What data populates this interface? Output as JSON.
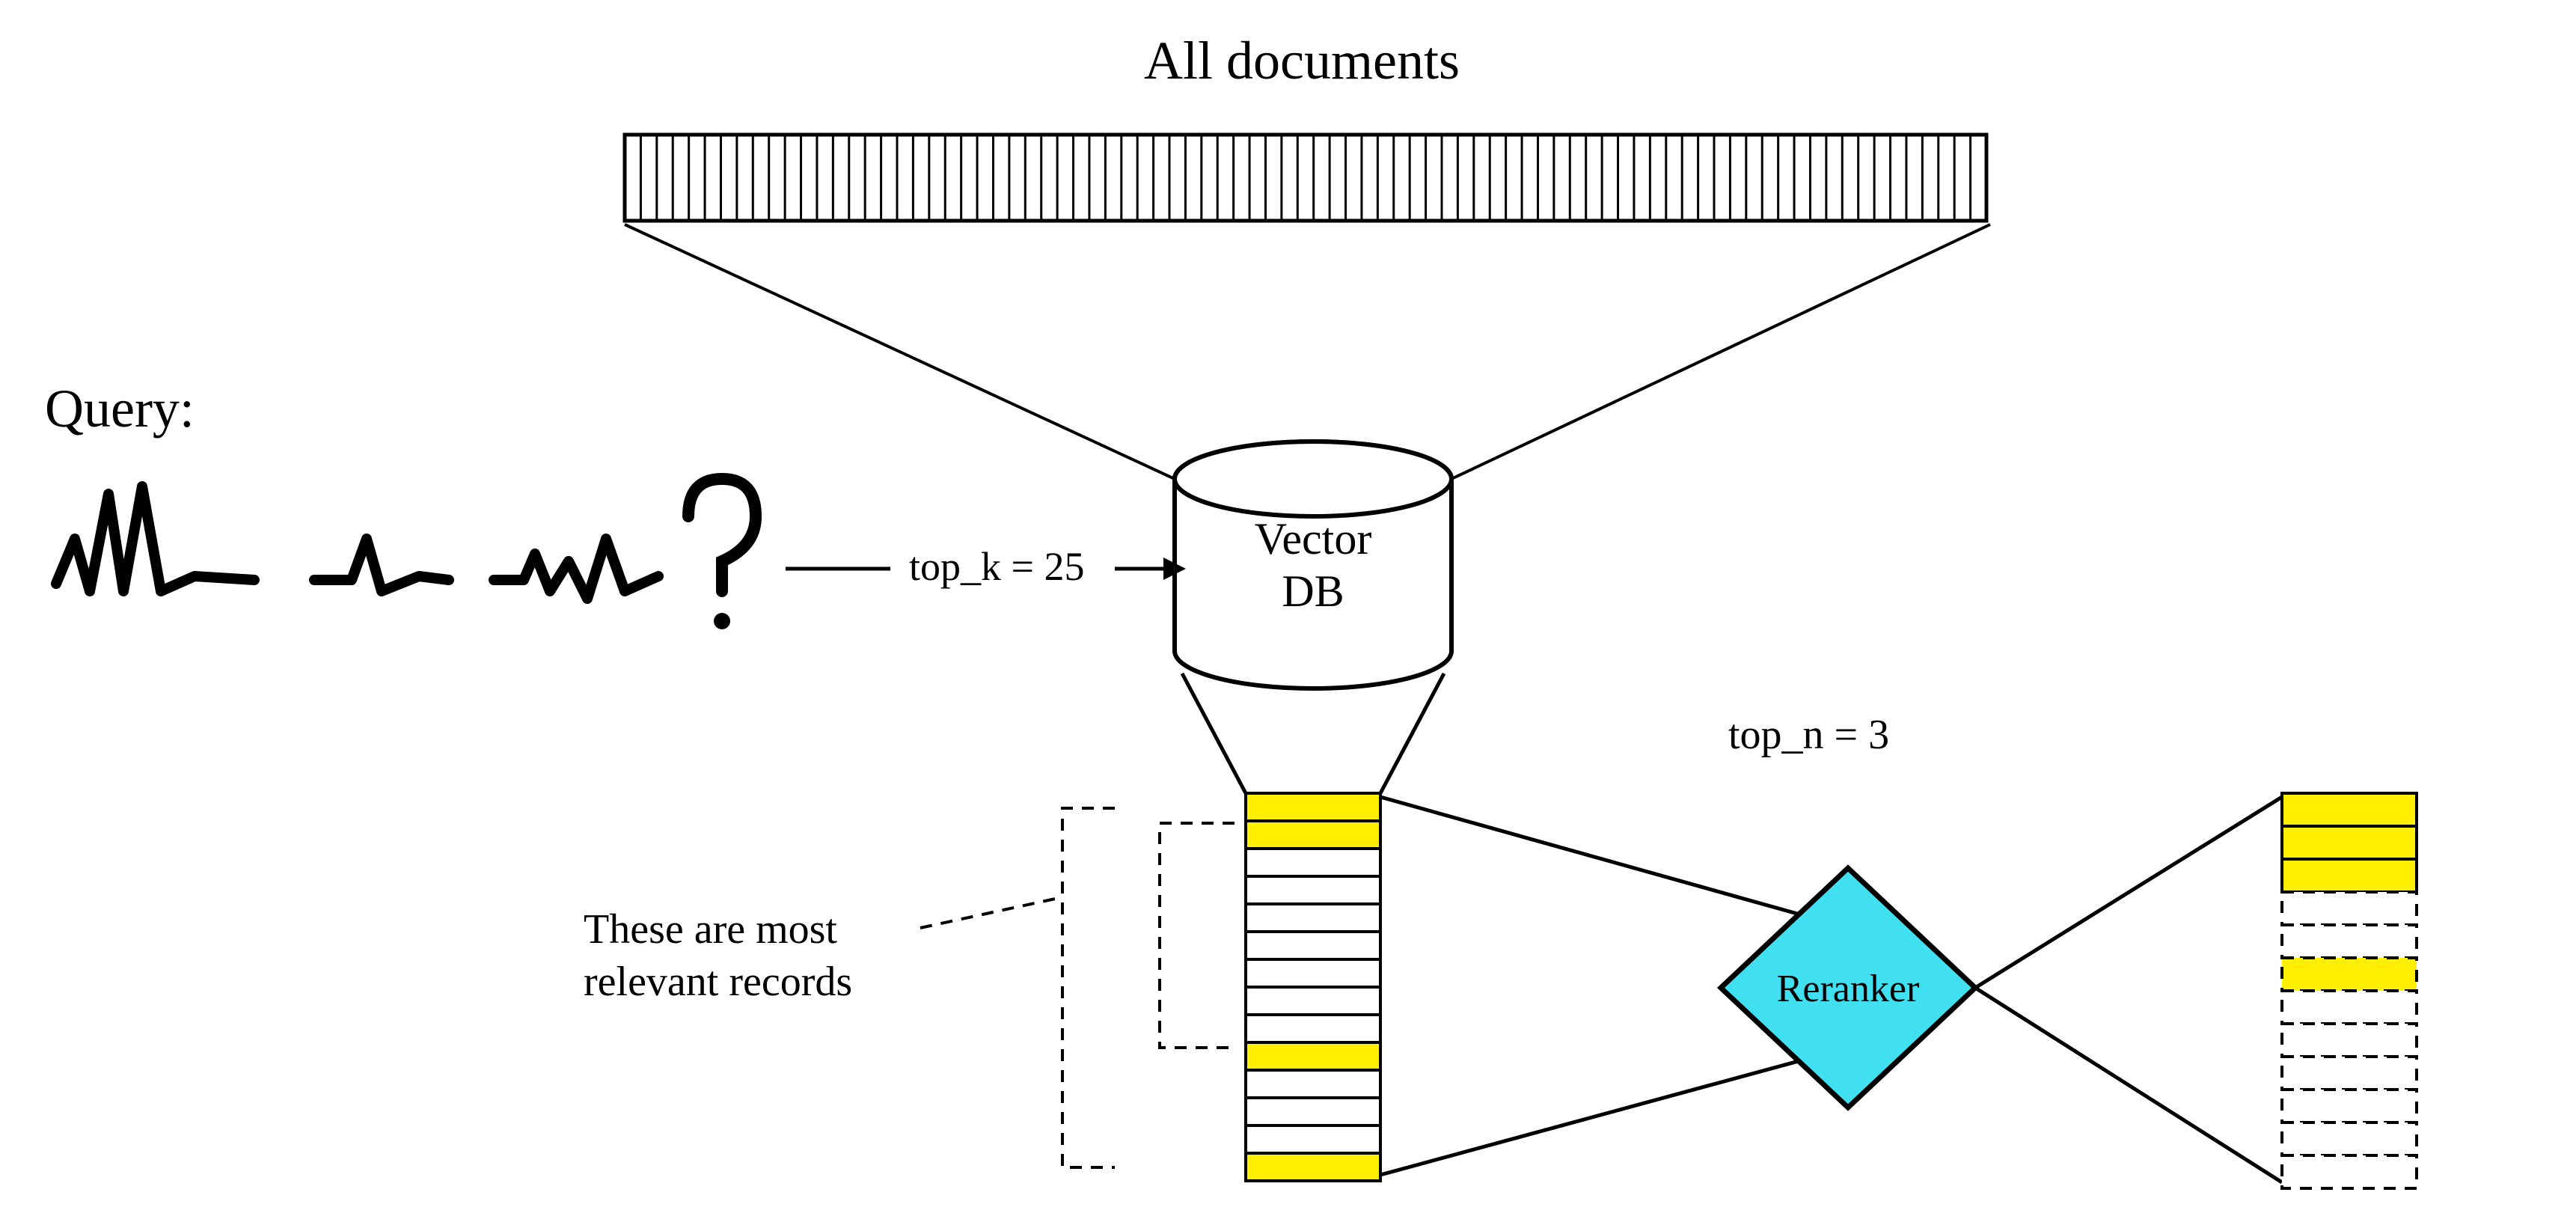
{
  "title": "All documents",
  "query_label": "Query:",
  "top_k_label": "top_k = 25",
  "vector_db_label_line1": "Vector",
  "vector_db_label_line2": "DB",
  "relevant_note_line1": "These are most",
  "relevant_note_line2": "relevant records",
  "reranker_label": "Reranker",
  "top_n_label": "top_n = 3",
  "document_count": 85,
  "retrieved_count": 14,
  "highlighted_retrieved_indices": [
    0,
    1,
    9,
    13
  ],
  "final_count": 12,
  "final_top_solid": 3,
  "final_extra_highlight_index": 5,
  "colors": {
    "highlight": "#ffef00",
    "reranker_fill": "#40e0f0",
    "stroke": "#000000"
  }
}
